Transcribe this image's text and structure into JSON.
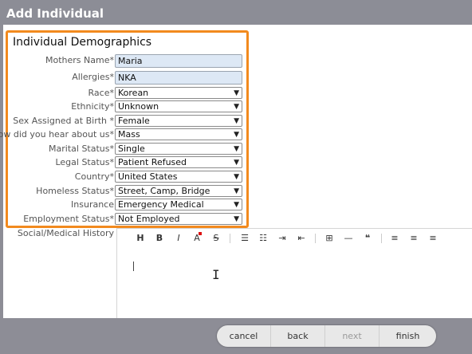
{
  "window": {
    "title": "Add Individual"
  },
  "section": {
    "title": "Individual Demographics"
  },
  "fields": [
    {
      "label": "Mothers Name",
      "required": true,
      "value": "Maria",
      "type": "text"
    },
    {
      "label": "Allergies",
      "required": true,
      "value": "NKA",
      "type": "text"
    },
    {
      "label": "Race",
      "required": true,
      "value": "Korean",
      "type": "select"
    },
    {
      "label": "Ethnicity",
      "required": true,
      "value": "Unknown",
      "type": "select"
    },
    {
      "label": "Sex Assigned at Birth ",
      "required": true,
      "value": "Female",
      "type": "select"
    },
    {
      "label": "How did you hear about us",
      "required": true,
      "value": "Mass",
      "type": "select"
    },
    {
      "label": "Marital Status",
      "required": true,
      "value": "Single",
      "type": "select"
    },
    {
      "label": "Legal Status",
      "required": true,
      "value": "Patient Refused",
      "type": "select"
    },
    {
      "label": "Country",
      "required": true,
      "value": "United States",
      "type": "select"
    },
    {
      "label": "Homeless Status",
      "required": true,
      "value": "Street, Camp, Bridge",
      "type": "select"
    },
    {
      "label": "Insurance",
      "required": false,
      "value": "Emergency Medical",
      "type": "select"
    },
    {
      "label": "Employment Status",
      "required": true,
      "value": "Not Employed",
      "type": "select"
    }
  ],
  "history": {
    "label": "Social/Medical History"
  },
  "toolbar": {
    "heading": "H",
    "bold": "B",
    "italic": "I",
    "color": "A",
    "strike": "S",
    "bullets": "☰",
    "numbers": "☷",
    "indent": "⇥",
    "outdent": "⇤",
    "table": "⊞",
    "hr": "—",
    "quote": "❝",
    "left": "≡",
    "center": "≡",
    "right": "≡"
  },
  "nav": {
    "cancel": "cancel",
    "back": "back",
    "next": "next",
    "finish": "finish"
  },
  "colors": {
    "accent": "#f28a1e",
    "titlebar": "#8c8d96",
    "input_bg": "#dde8f5"
  }
}
